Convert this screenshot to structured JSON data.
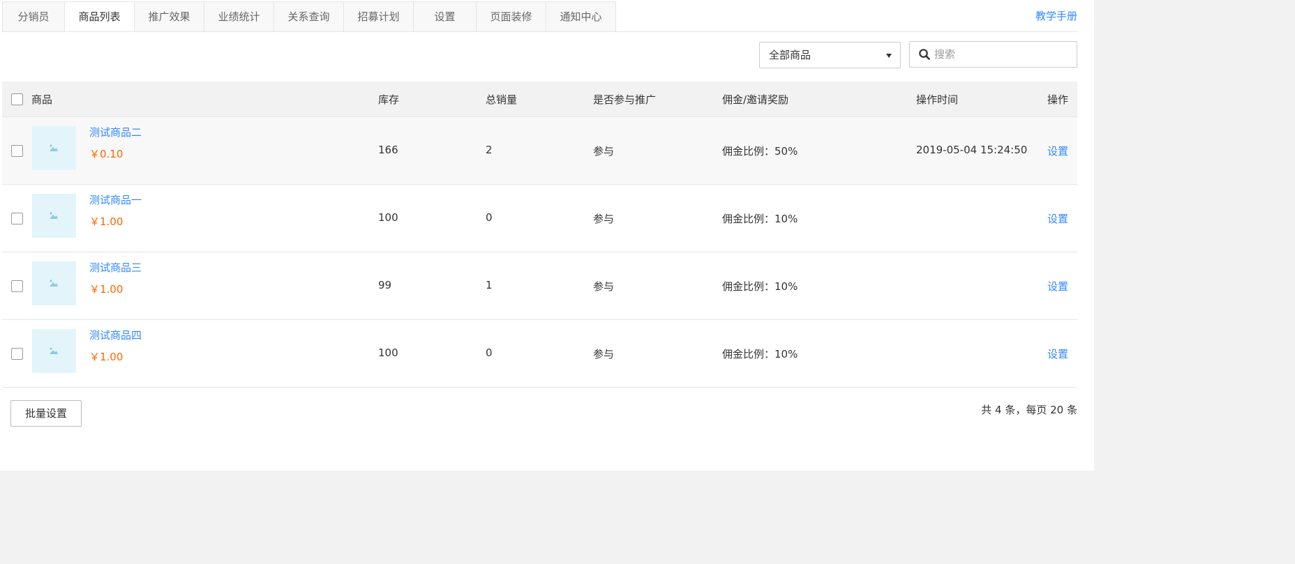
{
  "tabs": [
    {
      "label": "分销员",
      "active": false
    },
    {
      "label": "商品列表",
      "active": true
    },
    {
      "label": "推广效果",
      "active": false
    },
    {
      "label": "业绩统计",
      "active": false
    },
    {
      "label": "关系查询",
      "active": false
    },
    {
      "label": "招募计划",
      "active": false
    },
    {
      "label": "设置",
      "active": false
    },
    {
      "label": "页面装修",
      "active": false
    },
    {
      "label": "通知中心",
      "active": false
    }
  ],
  "manual_link": "教学手册",
  "filter": {
    "selected": "全部商品",
    "search_placeholder": "搜索"
  },
  "table": {
    "headers": {
      "product": "商品",
      "stock": "库存",
      "sales": "总销量",
      "promo": "是否参与推广",
      "commission": "佣金/邀请奖励",
      "time": "操作时间",
      "action": "操作"
    },
    "rows": [
      {
        "name": "测试商品二",
        "price": "￥0.10",
        "stock": "166",
        "sales": "2",
        "promo": "参与",
        "commission": "佣金比例：50%",
        "time": "2019-05-04 15:24:50",
        "action": "设置"
      },
      {
        "name": "测试商品一",
        "price": "￥1.00",
        "stock": "100",
        "sales": "0",
        "promo": "参与",
        "commission": "佣金比例：10%",
        "time": "",
        "action": "设置"
      },
      {
        "name": "测试商品三",
        "price": "￥1.00",
        "stock": "99",
        "sales": "1",
        "promo": "参与",
        "commission": "佣金比例：10%",
        "time": "",
        "action": "设置"
      },
      {
        "name": "测试商品四",
        "price": "￥1.00",
        "stock": "100",
        "sales": "0",
        "promo": "参与",
        "commission": "佣金比例：10%",
        "time": "",
        "action": "设置"
      }
    ]
  },
  "footer": {
    "batch_button": "批量设置",
    "pager_info": "共 4 条，每页 20 条"
  },
  "colors": {
    "accent": "#3388ff",
    "price": "#ff6600",
    "thumb_bg": "#e3f4fb"
  }
}
